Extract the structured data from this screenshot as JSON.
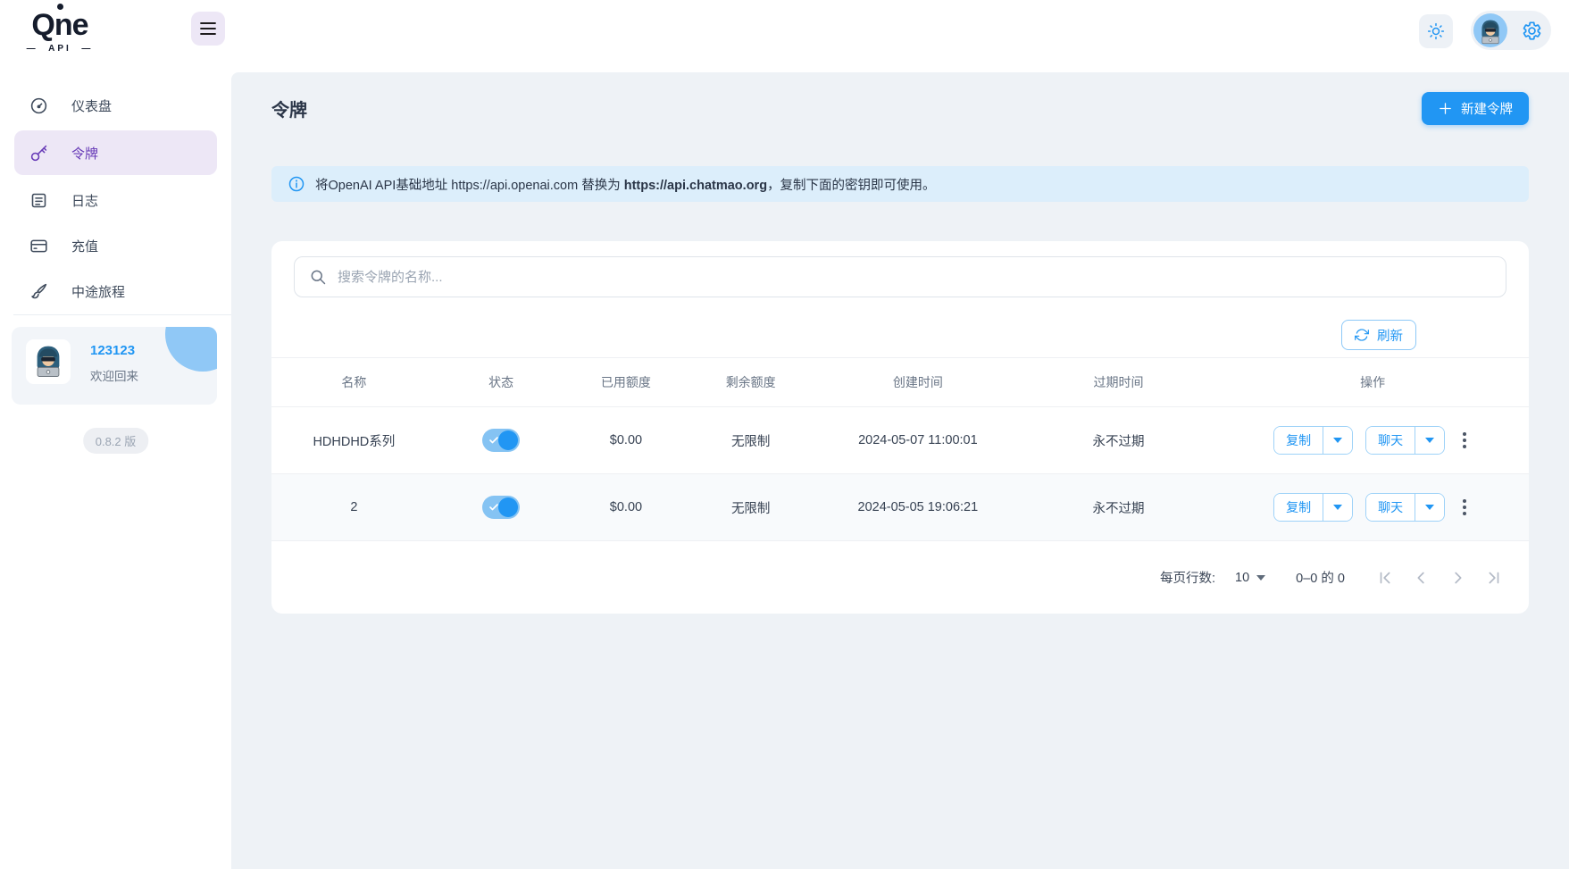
{
  "brand": {
    "name": "Qne",
    "subtitle": "API"
  },
  "sidebar": {
    "items": [
      {
        "label": "仪表盘"
      },
      {
        "label": "令牌"
      },
      {
        "label": "日志"
      },
      {
        "label": "充值"
      },
      {
        "label": "中途旅程"
      }
    ],
    "user": {
      "name": "123123",
      "greeting": "欢迎回来"
    },
    "version": "0.8.2 版"
  },
  "page": {
    "title": "令牌",
    "new_token_label": "新建令牌",
    "banner": {
      "text_before": "将OpenAI API基础地址 https://api.openai.com 替换为 ",
      "text_bold": "https://api.chatmao.org",
      "text_after": "，复制下面的密钥即可使用。"
    },
    "search": {
      "placeholder": "搜索令牌的名称..."
    },
    "refresh_label": "刷新"
  },
  "table": {
    "headers": {
      "name": "名称",
      "status": "状态",
      "used": "已用额度",
      "remaining": "剩余额度",
      "created": "创建时间",
      "expires": "过期时间",
      "actions": "操作"
    },
    "rows": [
      {
        "name": "HDHDHD系列",
        "used": "$0.00",
        "remaining": "无限制",
        "created": "2024-05-07 11:00:01",
        "expires": "永不过期",
        "status": "on"
      },
      {
        "name": "2",
        "used": "$0.00",
        "remaining": "无限制",
        "created": "2024-05-05 19:06:21",
        "expires": "永不过期",
        "status": "on"
      }
    ],
    "action_labels": {
      "copy": "复制",
      "chat": "聊天"
    }
  },
  "pagination": {
    "rows_per_page_label": "每页行数:",
    "rows_per_page_value": "10",
    "range_text": "0–0 的 0"
  },
  "colors": {
    "primary_blue": "#2196f3",
    "accent_purple": "#673ab7",
    "banner_bg": "#dceefb",
    "content_bg": "#eef2f6"
  }
}
